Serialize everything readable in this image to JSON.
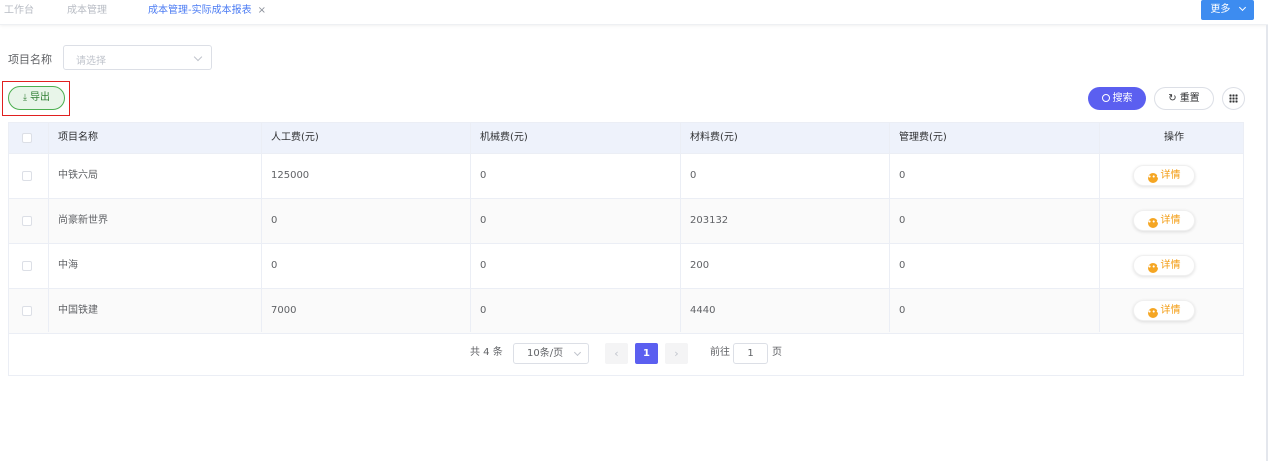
{
  "tabs": [
    {
      "label": "工作台"
    },
    {
      "label": "成本管理"
    },
    {
      "label": "成本管理-实际成本报表",
      "close": "×"
    }
  ],
  "more_button": {
    "label": "更多",
    "icon": "chevron-down-icon"
  },
  "filter": {
    "label": "项目名称",
    "placeholder": "请选择"
  },
  "toolbar": {
    "export_label": "导出",
    "search_label": "搜索",
    "reset_label": "重置"
  },
  "table": {
    "columns": [
      "项目名称",
      "人工费(元)",
      "机械费(元)",
      "材料费(元)",
      "管理费(元)",
      "操作"
    ],
    "rows": [
      {
        "name": "中铁六局",
        "labor": "125000",
        "machine": "0",
        "material": "0",
        "management": "0",
        "action": "详情"
      },
      {
        "name": "尚豪新世界",
        "labor": "0",
        "machine": "0",
        "material": "203132",
        "management": "0",
        "action": "详情"
      },
      {
        "name": "中海",
        "labor": "0",
        "machine": "0",
        "material": "200",
        "management": "0",
        "action": "详情"
      },
      {
        "name": "中国铁建",
        "labor": "7000",
        "machine": "0",
        "material": "4440",
        "management": "0",
        "action": "详情"
      }
    ]
  },
  "pagination": {
    "total": "共 4 条",
    "page_size": "10条/页",
    "current_page": "1",
    "goto_label": "前往",
    "goto_value": "1",
    "page_suffix": "页"
  },
  "colors": {
    "accent": "#5b5ff0",
    "tab_active": "#4c7cf3",
    "more_button": "#3d8cf0",
    "export_green": "#4caf50",
    "detail_orange": "#f39c12"
  }
}
